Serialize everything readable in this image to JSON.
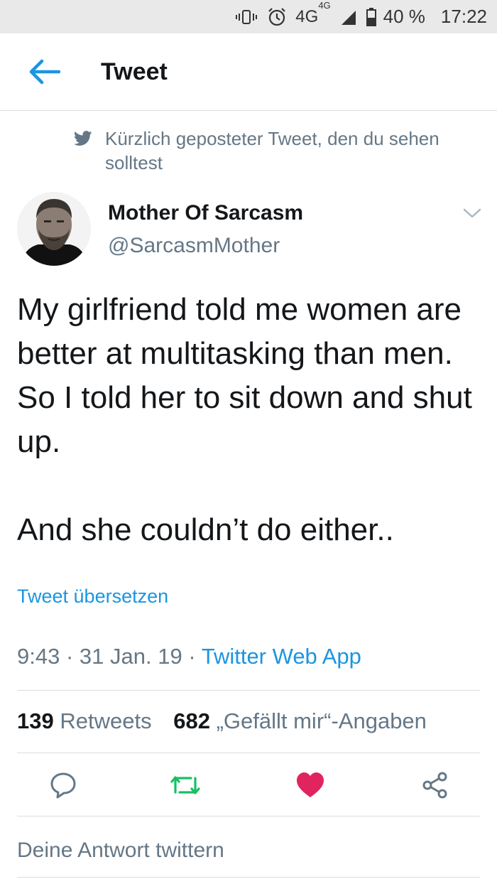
{
  "status_bar": {
    "network": "4G",
    "network_super": "4G",
    "battery": "40 %",
    "time": "17:22"
  },
  "app_bar": {
    "title": "Tweet"
  },
  "recent_label": "Kürzlich geposteter Tweet, den du sehen solltest",
  "author": {
    "name": "Mother Of Sarcasm",
    "handle": "@SarcasmMother"
  },
  "tweet": {
    "text": "My girlfriend told me women are better at multitasking than men. So I told her to sit down and shut up.\n\nAnd she couldn’t do either..",
    "translate_label": "Tweet übersetzen",
    "time": "9:43",
    "date": "31 Jan. 19",
    "source": "Twitter Web App"
  },
  "stats": {
    "retweets_count": "139",
    "retweets_label": "Retweets",
    "likes_count": "682",
    "likes_label": "„Gefällt mir“-Angaben"
  },
  "actions": {
    "retweet_color": "#17bf63",
    "like_color": "#e0245e"
  },
  "reply_placeholder": "Deine Antwort twittern",
  "colors": {
    "accent": "#1b95e0",
    "secondary_text": "#657786"
  }
}
